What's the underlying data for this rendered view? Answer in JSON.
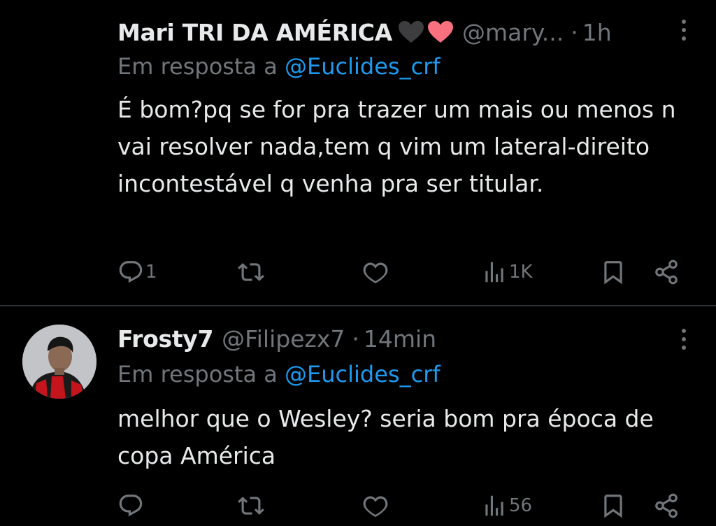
{
  "tweets": [
    {
      "name": "Mari TRI DA AMÉRICA",
      "emoji": [
        "black-heart",
        "pink-heart"
      ],
      "handle": "@mary...",
      "separator": "·",
      "time": "1h",
      "reply_prefix": "Em resposta a",
      "reply_to": "@Euclides_crf",
      "text": "É bom?pq se for pra trazer um mais ou menos n vai resolver nada,tem q vim um lateral-direito incontestável q venha pra ser titular.",
      "reply_count": "1",
      "repost_count": "",
      "like_count": "",
      "views": "1K"
    },
    {
      "name": "Frosty7",
      "handle": "@Filipezx7",
      "separator": "·",
      "time": "14min",
      "reply_prefix": "Em resposta a",
      "reply_to": "@Euclides_crf",
      "text": "melhor que o Wesley? seria bom pra época de copa América",
      "reply_count": "",
      "repost_count": "",
      "like_count": "",
      "views": "56"
    }
  ],
  "colors": {
    "background": "#000000",
    "text": "#e7e9ea",
    "muted": "#71767b",
    "link": "#1d9bf0",
    "divider": "#2f3336"
  },
  "icons": [
    "reply-icon",
    "repost-icon",
    "like-icon",
    "views-icon",
    "bookmark-icon",
    "share-icon",
    "more-icon"
  ]
}
